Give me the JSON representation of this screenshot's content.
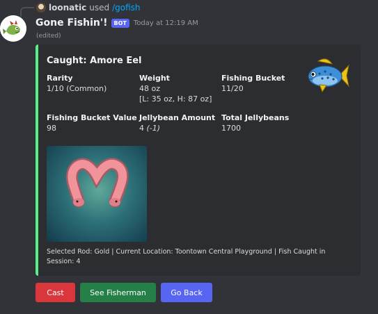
{
  "reply": {
    "username": "loonatic",
    "verb": "used",
    "command": "/gofish"
  },
  "message": {
    "bot_name": "Gone Fishin'!",
    "bot_badge": "BOT",
    "timestamp": "Today at 12:19 AM",
    "edited": "(edited)"
  },
  "embed": {
    "accent_color": "#57f287",
    "title": "Caught: Amore Eel",
    "fields": {
      "rarity": {
        "name": "Rarity",
        "value": "1/10 (Common)"
      },
      "weight": {
        "name": "Weight",
        "value": "48 oz",
        "value_line2": "[L: 35 oz, H: 87 oz]"
      },
      "fishing_bucket": {
        "name": "Fishing Bucket",
        "value": "11/20"
      },
      "fishing_bucket_value": {
        "name": "Fishing Bucket Value",
        "value": "98"
      },
      "jellybean_amount": {
        "name": "Jellybean Amount",
        "value": "4",
        "value_delta": "(-1)"
      },
      "total_jellybeans": {
        "name": "Total Jellybeans",
        "value": "1700"
      }
    },
    "footer": "Selected Rod: Gold | Current Location: Toontown Central Playground | Fish Caught in Session: 4"
  },
  "buttons": {
    "cast": {
      "label": "Cast",
      "color": "#da373c"
    },
    "see_fisherman": {
      "label": "See Fisherman",
      "color": "#248046"
    },
    "go_back": {
      "label": "Go Back",
      "color": "#5865f2"
    }
  },
  "icons": {
    "reply_avatar": "user-avatar-icon",
    "bot_avatar": "fish-bot-avatar-icon",
    "thumbnail": "fish-thumbnail-icon",
    "image": "amore-eel-image"
  }
}
